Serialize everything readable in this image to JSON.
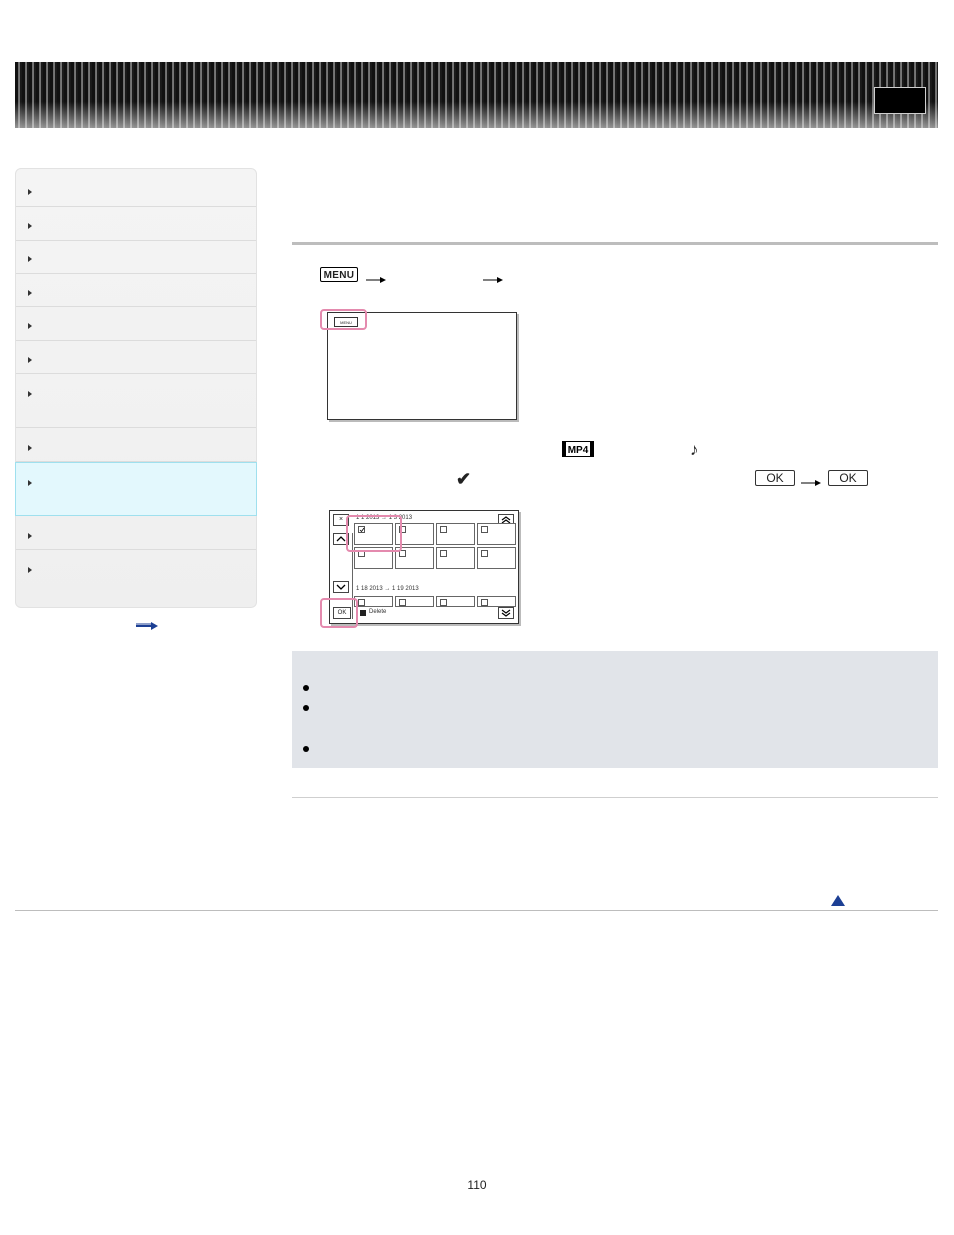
{
  "header": {
    "right_box_label": ""
  },
  "sidebar": {
    "items": [
      {
        "label": ""
      },
      {
        "label": ""
      },
      {
        "label": ""
      },
      {
        "label": ""
      },
      {
        "label": ""
      },
      {
        "label": ""
      },
      {
        "label": ""
      },
      {
        "label": ""
      },
      {
        "label": "",
        "active": true
      },
      {
        "label": ""
      },
      {
        "label": ""
      }
    ],
    "more_link_icon": "right-arrow-icon"
  },
  "steps": {
    "step1": {
      "menu_button_label": "MENU",
      "screen_menu_label": "MENU"
    },
    "step2": {
      "mp4_icon_label": "MP4",
      "music_icon": "♪",
      "check_icon": "✔",
      "ok_label_1": "OK",
      "ok_label_2": "OK"
    },
    "screen2": {
      "close_label": "×",
      "date_range_top": "1 1 2013 → 1 3 2013",
      "date_range_bottom": "1 18 2013 → 1 19 2013",
      "delete_label": "Delete",
      "ok_label": "OK"
    }
  },
  "colors": {
    "highlight": "#e48aae",
    "active_nav_bg": "#e3f8fd",
    "notes_bg": "#e1e4e9",
    "link_blue": "#1c3f94"
  },
  "footer": {
    "page_number": "110"
  }
}
